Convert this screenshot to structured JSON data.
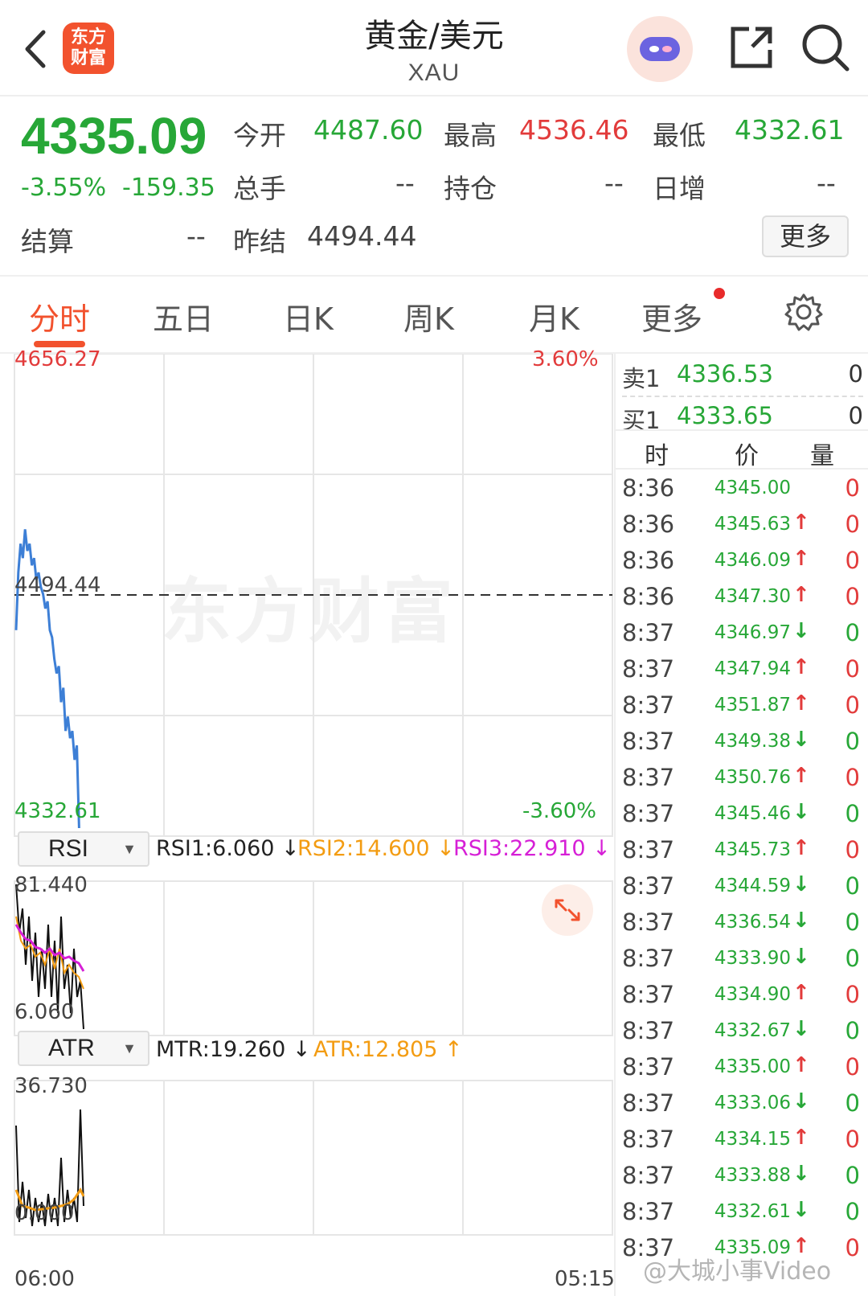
{
  "header": {
    "title": "黄金/美元",
    "subtitle": "XAU",
    "logo_text": "东方财富",
    "icons": [
      "back-icon",
      "robot-avatar-icon",
      "share-icon",
      "search-icon"
    ]
  },
  "quote": {
    "price": "4335.09",
    "change_pct": "-3.55%",
    "change": "-159.35",
    "open_label": "今开",
    "open": "4487.60",
    "high_label": "最高",
    "high": "4536.46",
    "low_label": "最低",
    "low": "4332.61",
    "volume_label": "总手",
    "volume": "--",
    "oi_label": "持仓",
    "oi": "--",
    "daily_inc_label": "日增",
    "daily_inc": "--",
    "settle_label": "结算",
    "settle": "--",
    "prev_settle_label": "昨结",
    "prev_settle": "4494.44",
    "more_label": "更多"
  },
  "tabs": [
    "分时",
    "五日",
    "日K",
    "周K",
    "月K",
    "更多"
  ],
  "chart": {
    "y_max": "4656.27",
    "y_min": "4332.61",
    "ref": "4494.44",
    "pct_max": "3.60%",
    "pct_min": "-3.60%",
    "x_start": "06:00",
    "x_end": "05:15",
    "bg_watermark": "东方财富"
  },
  "rsi": {
    "selector": "RSI",
    "rsi1": "RSI1:6.060 ↓",
    "rsi2": "RSI2:14.600 ↓",
    "rsi3": "RSI3:22.910 ↓",
    "top": "81.440",
    "bottom": "6.060"
  },
  "atr": {
    "selector": "ATR",
    "mtr": "MTR:19.260 ↓",
    "atr": "ATR:12.805 ↑",
    "top": "36.730",
    "bottom": "0.000"
  },
  "colors": {
    "up": "#e23b3b",
    "down": "#27a737",
    "accent": "#f2522e",
    "line": "#3d7fd6"
  },
  "chart_data": {
    "type": "line",
    "title": "",
    "xlabel": "",
    "ylabel": "",
    "x_range": [
      "06:00",
      "05:15"
    ],
    "ylim": [
      4332.61,
      4656.27
    ],
    "reference_line": 4494.44,
    "series": [
      {
        "values": [
          4470,
          4510,
          4530,
          4520,
          4540,
          4525,
          4530,
          4515,
          4520,
          4505,
          4510,
          4500,
          4495,
          4485,
          4490,
          4470,
          4465,
          4450,
          4440,
          4445,
          4420,
          4430,
          4400,
          4410,
          4395,
          4400,
          4380,
          4390,
          4332.61
        ]
      }
    ]
  },
  "order_book": {
    "sell_label": "卖1",
    "sell_price": "4336.53",
    "sell_vol": "0",
    "buy_label": "买1",
    "buy_price": "4333.65",
    "buy_vol": "0"
  },
  "ticks_header": {
    "time": "时",
    "price": "价",
    "vol": "量"
  },
  "ticks": [
    {
      "time": "8:36",
      "price": "4345.00",
      "dir": "",
      "vol": "0",
      "up": true
    },
    {
      "time": "8:36",
      "price": "4345.63",
      "dir": "↑",
      "vol": "0",
      "up": true
    },
    {
      "time": "8:36",
      "price": "4346.09",
      "dir": "↑",
      "vol": "0",
      "up": true
    },
    {
      "time": "8:36",
      "price": "4347.30",
      "dir": "↑",
      "vol": "0",
      "up": true
    },
    {
      "time": "8:37",
      "price": "4346.97",
      "dir": "↓",
      "vol": "0",
      "up": false
    },
    {
      "time": "8:37",
      "price": "4347.94",
      "dir": "↑",
      "vol": "0",
      "up": true
    },
    {
      "time": "8:37",
      "price": "4351.87",
      "dir": "↑",
      "vol": "0",
      "up": true
    },
    {
      "time": "8:37",
      "price": "4349.38",
      "dir": "↓",
      "vol": "0",
      "up": false
    },
    {
      "time": "8:37",
      "price": "4350.76",
      "dir": "↑",
      "vol": "0",
      "up": true
    },
    {
      "time": "8:37",
      "price": "4345.46",
      "dir": "↓",
      "vol": "0",
      "up": false
    },
    {
      "time": "8:37",
      "price": "4345.73",
      "dir": "↑",
      "vol": "0",
      "up": true
    },
    {
      "time": "8:37",
      "price": "4344.59",
      "dir": "↓",
      "vol": "0",
      "up": false
    },
    {
      "time": "8:37",
      "price": "4336.54",
      "dir": "↓",
      "vol": "0",
      "up": false
    },
    {
      "time": "8:37",
      "price": "4333.90",
      "dir": "↓",
      "vol": "0",
      "up": false
    },
    {
      "time": "8:37",
      "price": "4334.90",
      "dir": "↑",
      "vol": "0",
      "up": true
    },
    {
      "time": "8:37",
      "price": "4332.67",
      "dir": "↓",
      "vol": "0",
      "up": false
    },
    {
      "time": "8:37",
      "price": "4335.00",
      "dir": "↑",
      "vol": "0",
      "up": true
    },
    {
      "time": "8:37",
      "price": "4333.06",
      "dir": "↓",
      "vol": "0",
      "up": false
    },
    {
      "time": "8:37",
      "price": "4334.15",
      "dir": "↑",
      "vol": "0",
      "up": true
    },
    {
      "time": "8:37",
      "price": "4333.88",
      "dir": "↓",
      "vol": "0",
      "up": false
    },
    {
      "time": "8:37",
      "price": "4332.61",
      "dir": "↓",
      "vol": "0",
      "up": false
    },
    {
      "time": "8:37",
      "price": "4335.09",
      "dir": "↑",
      "vol": "0",
      "up": true
    }
  ],
  "watermark": "@大城小事Video"
}
